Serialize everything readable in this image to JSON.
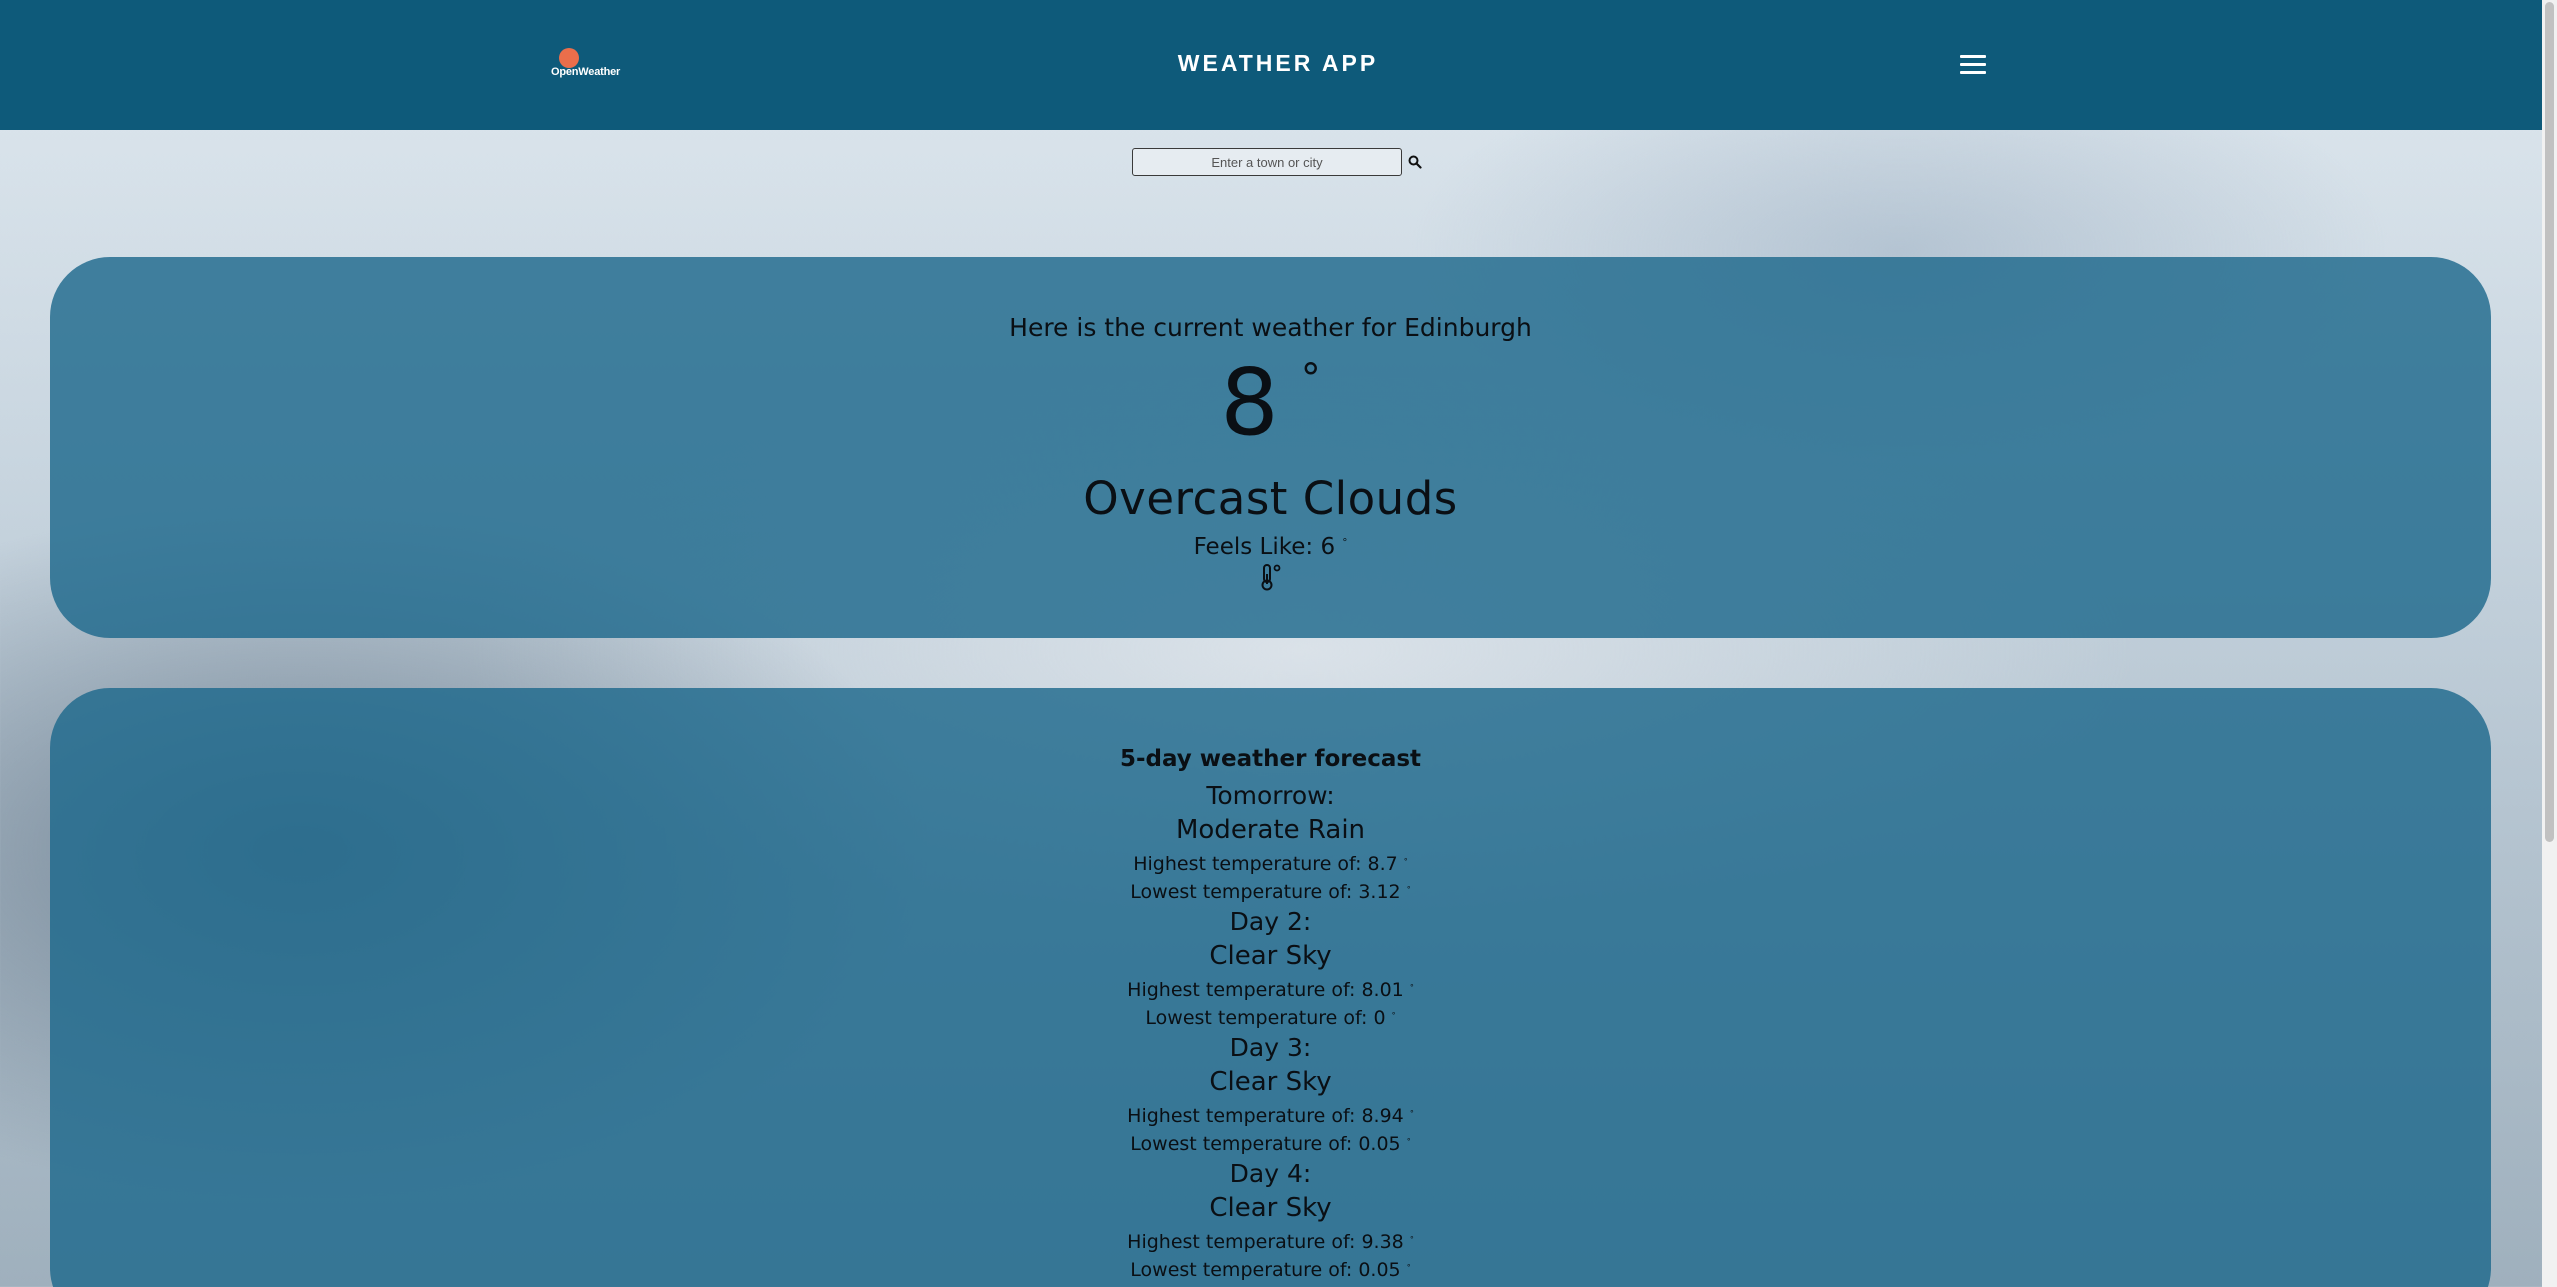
{
  "header": {
    "logo_text": "OpenWeather",
    "title": "WEATHER APP",
    "menu_icon": "hamburger-menu-icon"
  },
  "search": {
    "placeholder": "Enter a town or city",
    "value": "",
    "button_icon": "search-icon"
  },
  "current": {
    "heading": "Here is the current weather for Edinburgh",
    "temperature": "8",
    "degree_symbol": "°",
    "description": "Overcast Clouds",
    "feels_like_label": "Feels Like: 6",
    "feels_like_unit": "°",
    "icon": "thermometer-icon"
  },
  "forecast": {
    "heading": "5-day weather forecast",
    "days": [
      {
        "label": "Tomorrow:",
        "description": "Moderate Rain",
        "high": "Highest temperature of: 8.7",
        "low": "Lowest temperature of: 3.12"
      },
      {
        "label": "Day 2:",
        "description": "Clear Sky",
        "high": "Highest temperature of: 8.01",
        "low": "Lowest temperature of: 0"
      },
      {
        "label": "Day 3:",
        "description": "Clear Sky",
        "high": "Highest temperature of: 8.94",
        "low": "Lowest temperature of: 0.05"
      },
      {
        "label": "Day 4:",
        "description": "Clear Sky",
        "high": "Highest temperature of: 9.38",
        "low": "Lowest temperature of: 0.05"
      }
    ],
    "degree_symbol": "°"
  },
  "colors": {
    "header_bg": "#0e5a7a",
    "panel_bg": "#1e698c",
    "logo_sun": "#eb6e4b"
  }
}
